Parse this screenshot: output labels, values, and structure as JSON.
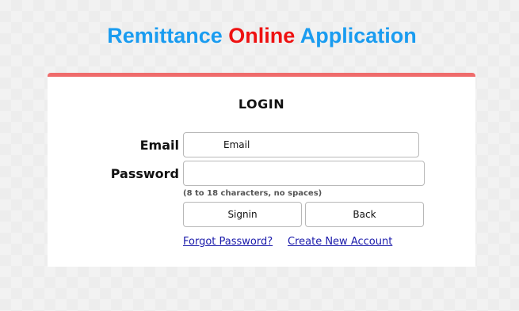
{
  "header": {
    "title_part1": "Remittance",
    "title_part2": "Online",
    "title_part3": "Application"
  },
  "login": {
    "heading": "LOGIN",
    "email_label": "Email",
    "email_placeholder": "Email",
    "email_value": "",
    "password_label": "Password",
    "password_value": "",
    "password_hint": "(8 to 18 characters, no spaces)",
    "signin_label": "Signin",
    "back_label": "Back",
    "forgot_password_link": "Forgot Password?",
    "create_account_link": "Create New Account"
  },
  "colors": {
    "title_blue": "#1a9cf0",
    "title_red": "#ee1111",
    "card_top_border": "#ef6b6b",
    "link": "#1a1aaa"
  }
}
